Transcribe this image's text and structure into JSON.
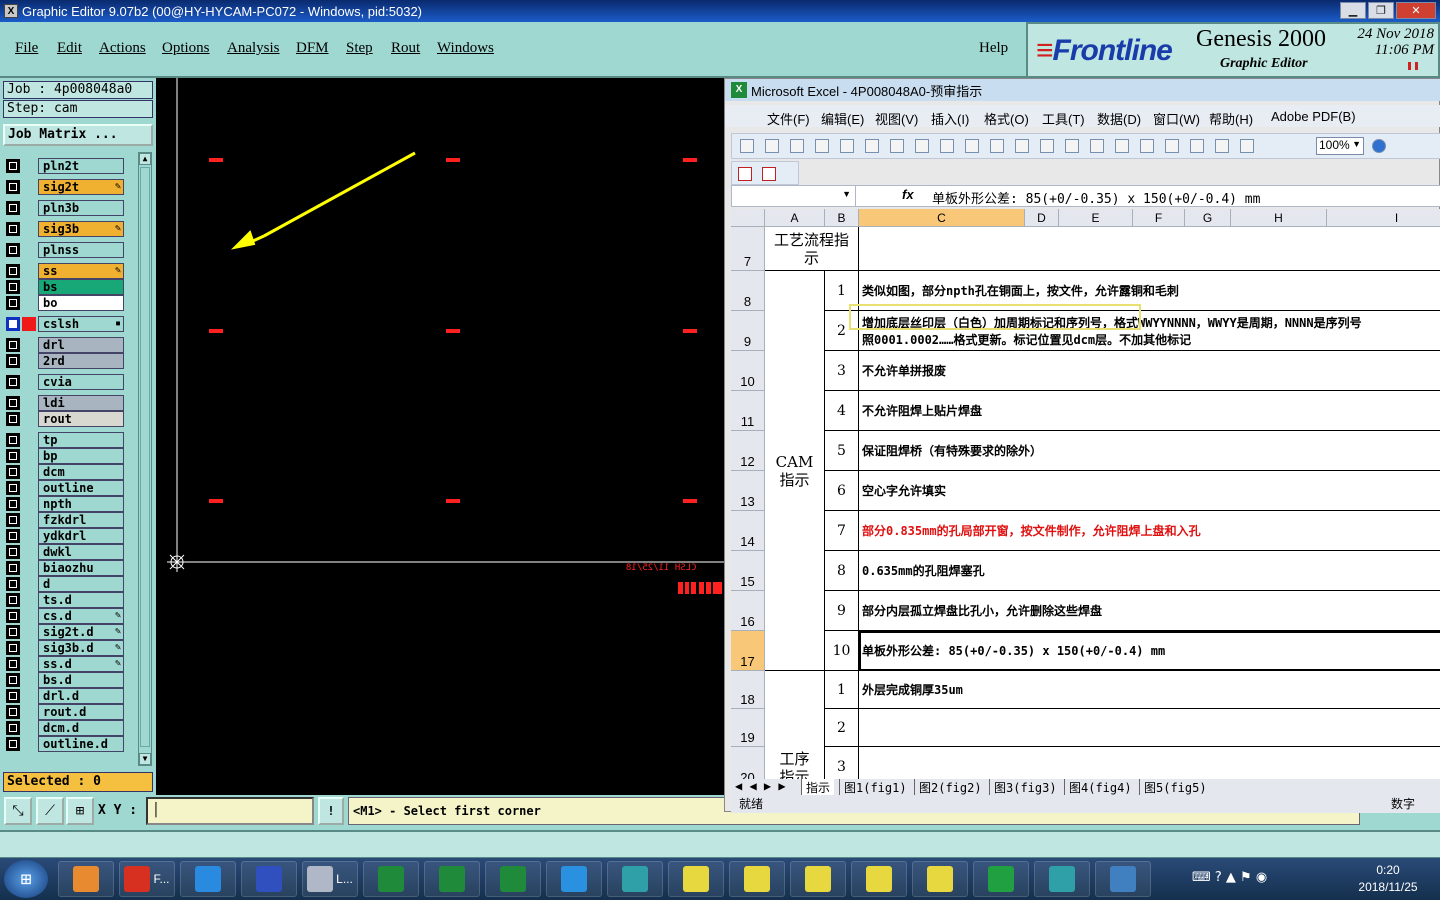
{
  "genesis_window": {
    "title": "Graphic Editor 9.07b2 (00@HY-HYCAM-PC072 - Windows, pid:5032)",
    "menu": [
      "File",
      "Edit",
      "Actions",
      "Options",
      "Analysis",
      "DFM",
      "Step",
      "Rout",
      "Windows"
    ],
    "help": "Help",
    "logo_text": "Frontline",
    "product": "Genesis 2000",
    "product_sub": "Graphic Editor",
    "date": "24 Nov 2018",
    "time": "11:06 PM"
  },
  "job_panel": {
    "job": "Job : 4p008048a0",
    "step": "Step: cam",
    "job_matrix": "Job Matrix ...",
    "selected": "Selected : 0",
    "layers": [
      {
        "name": "pln2t",
        "style": "plain"
      },
      {
        "name": "sig2t",
        "style": "gold",
        "edit": true
      },
      {
        "name": "pln3b",
        "style": "plain"
      },
      {
        "name": "sig3b",
        "style": "gold",
        "edit": true
      },
      {
        "name": "plnss",
        "style": "plain"
      },
      {
        "name": "ss",
        "style": "gold",
        "edit": true
      },
      {
        "name": "bs",
        "style": "green"
      },
      {
        "name": "bo",
        "style": "white"
      },
      {
        "name": "cslsh",
        "style": "plain",
        "active": true
      },
      {
        "name": "drl",
        "style": "gray"
      },
      {
        "name": "2rd",
        "style": "gray"
      },
      {
        "name": "cvia",
        "style": "plain"
      },
      {
        "name": "ldi",
        "style": "gray"
      },
      {
        "name": "rout",
        "style": "lt"
      },
      {
        "name": "tp",
        "style": "plain"
      },
      {
        "name": "bp",
        "style": "plain"
      },
      {
        "name": "dcm",
        "style": "plain"
      },
      {
        "name": "outline",
        "style": "plain"
      },
      {
        "name": "npth",
        "style": "plain"
      },
      {
        "name": "fzkdrl",
        "style": "plain"
      },
      {
        "name": "ydkdrl",
        "style": "plain"
      },
      {
        "name": "dwkl",
        "style": "plain"
      },
      {
        "name": "biaozhu",
        "style": "plain"
      },
      {
        "name": "d",
        "style": "plain"
      },
      {
        "name": "ts.d",
        "style": "plain"
      },
      {
        "name": "cs.d",
        "style": "plain",
        "edit": true
      },
      {
        "name": "sig2t.d",
        "style": "plain",
        "edit": true
      },
      {
        "name": "sig3b.d",
        "style": "plain",
        "edit": true
      },
      {
        "name": "ss.d",
        "style": "plain",
        "edit": true
      },
      {
        "name": "bs.d",
        "style": "plain"
      },
      {
        "name": "drl.d",
        "style": "plain"
      },
      {
        "name": "rout.d",
        "style": "plain"
      },
      {
        "name": "dcm.d",
        "style": "plain"
      },
      {
        "name": "outline.d",
        "style": "plain"
      }
    ]
  },
  "canvas": {
    "mirror_text": "CLSH 11/25/18",
    "colors": {
      "background": "#000000",
      "marks": "#ff2020",
      "arrow": "#ffff00",
      "outline": "#ffffff"
    }
  },
  "bottom_bar": {
    "xy_label": "X Y :",
    "xy_value": "",
    "prompt": "<M1> - Select first corner"
  },
  "excel": {
    "title": "Microsoft Excel - 4P008048A0-预审指示",
    "menu": [
      "文件(F)",
      "编辑(E)",
      "视图(V)",
      "插入(I)",
      "格式(O)",
      "工具(T)",
      "数据(D)",
      "窗口(W)",
      "帮助(H)",
      "Adobe PDF(B)"
    ],
    "zoom": "100%",
    "fx": "fx",
    "formula": "单板外形公差:   85(+0/-0.35) x 150(+0/-0.4) mm",
    "columns": [
      "A",
      "B",
      "C",
      "D",
      "E",
      "F",
      "G",
      "H",
      "I"
    ],
    "rows": [
      {
        "row": "7",
        "a": "工艺流程指示",
        "b": "",
        "c": ""
      },
      {
        "row": "8",
        "b": "1",
        "c": "类似如图，部分npth孔在铜面上，按文件，允许露铜和毛刺"
      },
      {
        "row": "9",
        "b": "2",
        "c": "增加底层丝印层（白色）加周期标记和序列号，格式WWYYNNNN，WWYY是周期，NNNN是序列号",
        "c2": "照0001.0002……格式更新。标记位置见dcm层。不加其他标记"
      },
      {
        "row": "10",
        "b": "3",
        "c": "不允许单拼报废"
      },
      {
        "row": "11",
        "b": "4",
        "c": "不允许阻焊上贴片焊盘"
      },
      {
        "row": "12",
        "b": "5",
        "c": "保证阻焊桥（有特殊要求的除外）"
      },
      {
        "row": "13",
        "b": "6",
        "c": "空心字允许填实"
      },
      {
        "row": "14",
        "b": "7",
        "c": "部分0.835mm的孔局部开窗，按文件制作，允许阻焊上盘和入孔",
        "red": true
      },
      {
        "row": "15",
        "b": "8",
        "c": "0.635mm的孔阻焊塞孔"
      },
      {
        "row": "16",
        "b": "9",
        "c": "部分内层孤立焊盘比孔小，允许删除这些焊盘"
      },
      {
        "row": "17",
        "b": "10",
        "c": "单板外形公差:   85(+0/-0.35) x 150(+0/-0.4) mm"
      },
      {
        "row": "18",
        "b": "1",
        "c": "外层完成铜厚35um"
      },
      {
        "row": "19",
        "b": "2",
        "c": ""
      },
      {
        "row": "20",
        "b": "3",
        "c": ""
      }
    ],
    "cam_label": "CAM指示",
    "process_label": "工序指示",
    "sheet_tabs": [
      "指示",
      "图1(fig1)",
      "图2(fig2)",
      "图3(fig3)",
      "图4(fig4)",
      "图5(fig5)"
    ],
    "status_left": "就绪",
    "status_right": "数字"
  },
  "taskbar": {
    "items": [
      {
        "label": "",
        "icon": "shell-icon",
        "color": "#e88a30"
      },
      {
        "label": "F...",
        "icon": "genesis-icon",
        "color": "#d83020"
      },
      {
        "label": "",
        "icon": "ie-icon",
        "color": "#2a8ae0"
      },
      {
        "label": "",
        "icon": "floppy-icon",
        "color": "#3050c0"
      },
      {
        "label": "L...",
        "icon": "scroll-icon",
        "color": "#b0b8c8"
      },
      {
        "label": "",
        "icon": "excel-icon",
        "color": "#1f8a3a"
      },
      {
        "label": "",
        "icon": "excel-icon",
        "color": "#1f8a3a"
      },
      {
        "label": "",
        "icon": "excel-icon",
        "color": "#1f8a3a"
      },
      {
        "label": "",
        "icon": "feather-icon",
        "color": "#2a90e0"
      },
      {
        "label": "",
        "icon": "eye-icon",
        "color": "#30a0a8"
      },
      {
        "label": "",
        "icon": "x-window-icon",
        "color": "#e8d840"
      },
      {
        "label": "",
        "icon": "x-window-icon",
        "color": "#e8d840"
      },
      {
        "label": "",
        "icon": "x-window-icon",
        "color": "#e8d840"
      },
      {
        "label": "",
        "icon": "x-window-icon",
        "color": "#e8d840"
      },
      {
        "label": "",
        "icon": "x-window-icon",
        "color": "#e8d840"
      },
      {
        "label": "",
        "icon": "frontline-f-icon",
        "color": "#20a040"
      },
      {
        "label": "",
        "icon": "eye-icon",
        "color": "#30a0a8"
      },
      {
        "label": "",
        "icon": "monitor-icon",
        "color": "#4080c0"
      }
    ],
    "time": "0:20",
    "date": "2018/11/25"
  }
}
